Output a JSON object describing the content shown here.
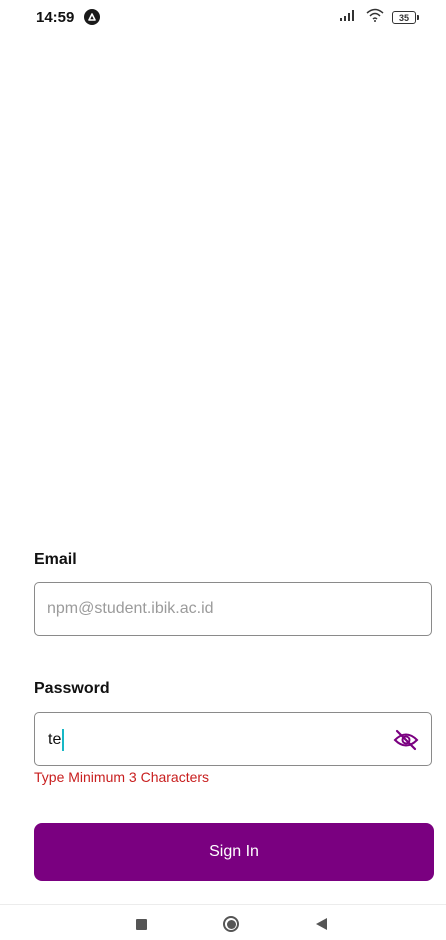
{
  "status_bar": {
    "time": "14:59",
    "battery": "35",
    "app_icon": "a-circle-icon",
    "signal_icon": "signal-icon",
    "wifi_icon": "wifi-icon"
  },
  "form": {
    "email": {
      "label": "Email",
      "placeholder": "npm@student.ibik.ac.id",
      "value": ""
    },
    "password": {
      "label": "Password",
      "value": "te",
      "error": "Type Minimum 3 Characters",
      "toggle_icon": "eye-off-icon"
    },
    "signin_label": "Sign In"
  },
  "nav_bar": {
    "recents_icon": "square-icon",
    "home_icon": "circle-icon",
    "back_icon": "triangle-back-icon"
  },
  "colors": {
    "primary": "#7a0080",
    "error": "#c81e1e",
    "caret": "#17b8c6"
  }
}
